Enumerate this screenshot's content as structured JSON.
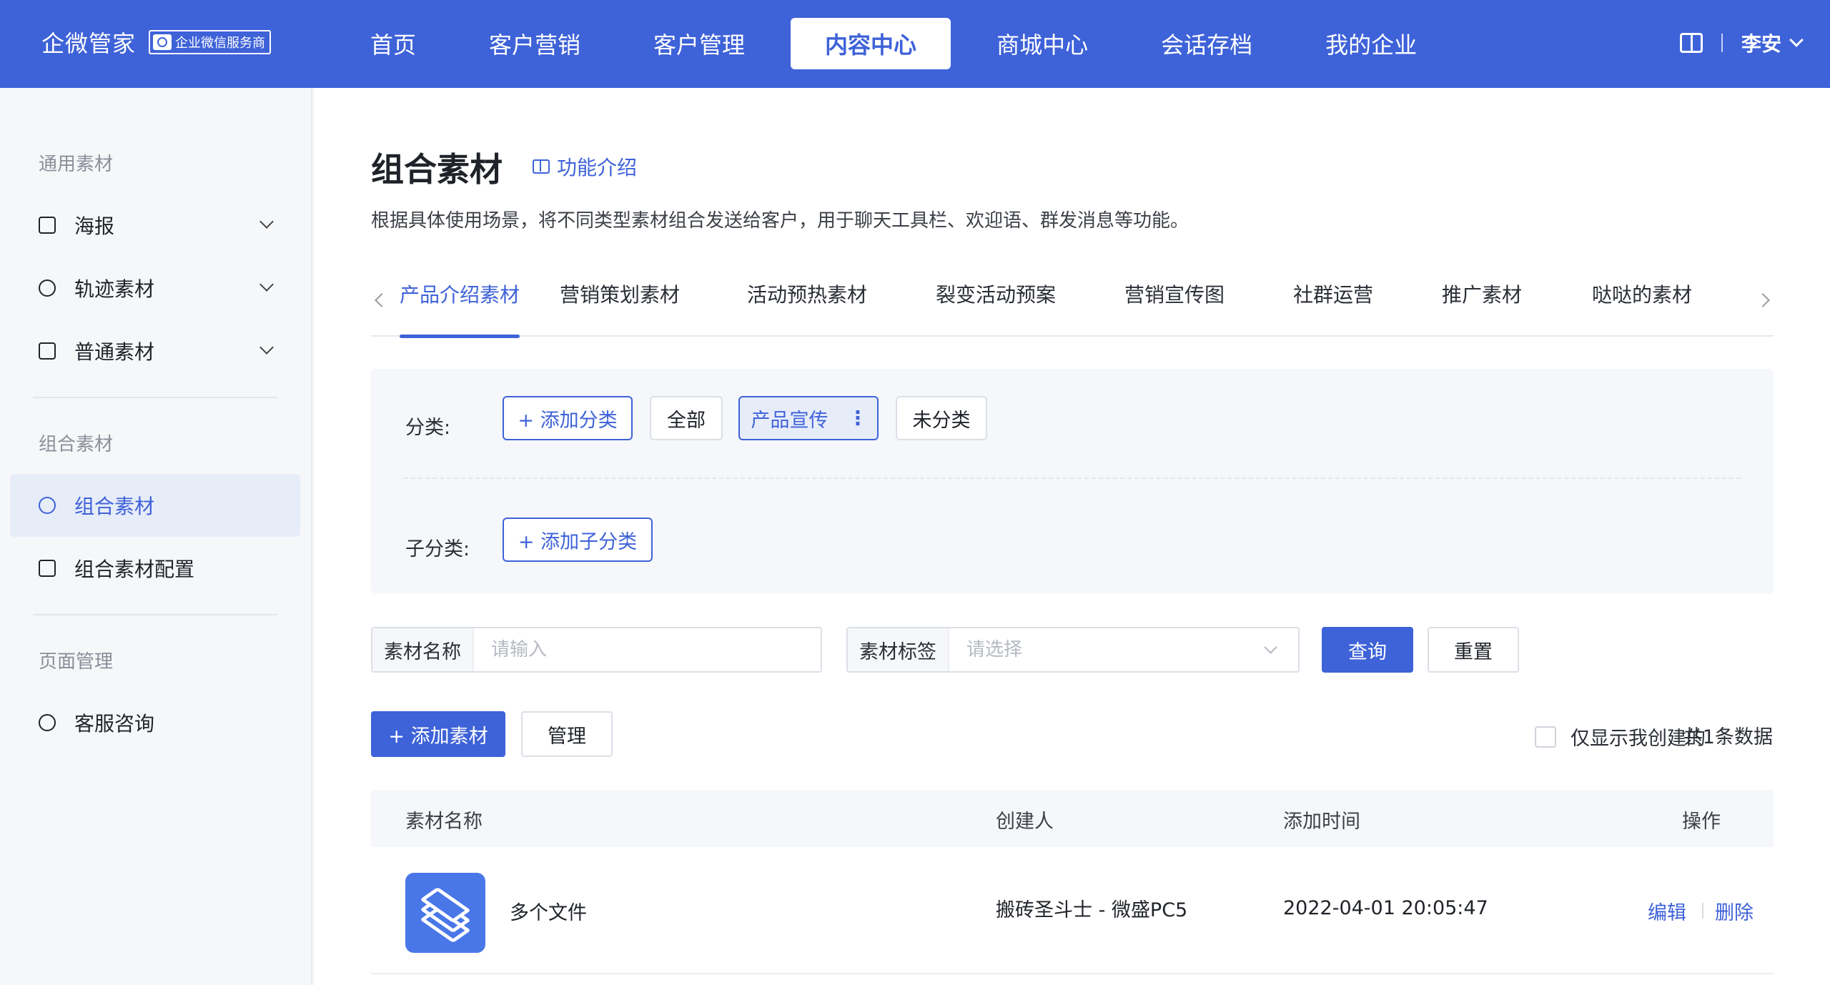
{
  "header": {
    "brand": "企微管家",
    "badge": "企业微信服务商",
    "nav": [
      "首页",
      "客户营销",
      "客户管理",
      "内容中心",
      "商城中心",
      "会话存档",
      "我的企业"
    ],
    "active_nav": "内容中心",
    "user": "李安",
    "icons": [
      "book-icon",
      "chevron-down-icon"
    ]
  },
  "sidebar": {
    "groups": [
      {
        "title": "通用素材",
        "items": [
          {
            "label": "海报",
            "icon": "image-icon"
          },
          {
            "label": "轨迹素材",
            "icon": "user-pin-icon"
          },
          {
            "label": "普通素材",
            "icon": "image-add-icon"
          }
        ]
      },
      {
        "title": "组合素材",
        "items": [
          {
            "label": "组合素材",
            "icon": "combo-icon"
          },
          {
            "label": "组合素材配置",
            "icon": "copy-icon"
          }
        ]
      },
      {
        "title": "页面管理",
        "items": [
          {
            "label": "客服咨询",
            "icon": "headset-icon"
          }
        ]
      }
    ]
  },
  "page": {
    "title": "组合素材",
    "intro_link": "功能介绍",
    "description": "根据具体使用场景，将不同类型素材组合发送给客户，用于聊天工具栏、欢迎语、群发消息等功能。",
    "tabs": [
      "产品介绍素材",
      "营销策划素材",
      "活动预热素材",
      "裂变活动预案",
      "营销宣传图",
      "社群运营",
      "推广素材",
      "哒哒的素材"
    ],
    "active_tab": "产品介绍素材"
  },
  "filters": {
    "category_label": "分类:",
    "add_category": "+ 添加分类",
    "categories": [
      "全部",
      "产品宣传",
      "未分类"
    ],
    "selected_category": "产品宣传",
    "more_glyph": "⋮",
    "subcategory_label": "子分类:",
    "add_subcategory": "+ 添加子分类"
  },
  "search": {
    "name_label": "素材名称",
    "name_placeholder": "请输入",
    "tag_label": "素材标签",
    "tag_placeholder": "请选择",
    "query": "查询",
    "reset": "重置"
  },
  "actions": {
    "add": "+ 添加素材",
    "manage": "管理",
    "only_mine": "仅显示我创建的",
    "count": "共1条数据"
  },
  "table": {
    "columns": [
      "素材名称",
      "创建人",
      "添加时间",
      "操作"
    ],
    "rows": [
      {
        "name": "多个文件",
        "creator": "搬砖圣斗士 - 微盛PC5",
        "time": "2022-04-01 20:05:47",
        "ops": [
          "编辑",
          "删除"
        ]
      }
    ]
  },
  "colors": {
    "primary": "#3e62d8",
    "thumb": "#4a77e8"
  }
}
